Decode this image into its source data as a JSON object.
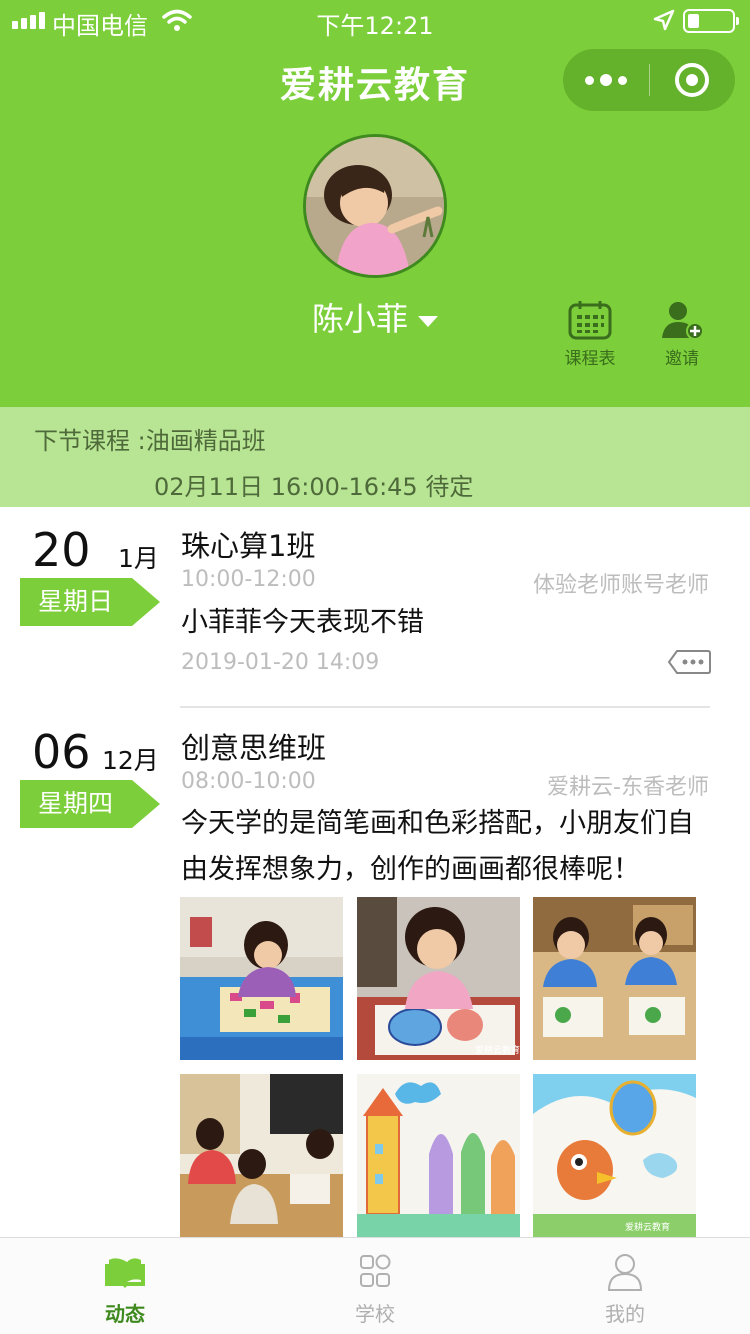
{
  "status_bar": {
    "carrier": "中国电信",
    "time": "下午12:21"
  },
  "header": {
    "title": "爱耕云教育",
    "student_name": "陈小菲",
    "tools": [
      {
        "label": "课程表",
        "icon": "calendar-icon"
      },
      {
        "label": "邀请",
        "icon": "invite-user-icon"
      }
    ]
  },
  "next_course": {
    "line1": "下节课程 :油画精品班",
    "line2": "02月11日 16:00-16:45 待定"
  },
  "entries": [
    {
      "day": "20",
      "month": "1月",
      "weekday": "星期日",
      "course": "珠心算1班",
      "time": "10:00-12:00",
      "teacher": "体验老师账号老师",
      "comment": "小菲菲今天表现不错",
      "posted": "2019-01-20 14:09"
    },
    {
      "day": "06",
      "month": "12月",
      "weekday": "星期四",
      "course": "创意思维班",
      "time": "08:00-10:00",
      "teacher": "爱耕云-东香老师",
      "comment": "今天学的是简笔画和色彩搭配，小朋友们自由发挥想象力，创作的画画都很棒呢！",
      "photo_watermark": "爱耕云教育"
    }
  ],
  "tabbar": {
    "tabs": [
      {
        "label": "动态",
        "icon": "open-book-icon",
        "active": true
      },
      {
        "label": "学校",
        "icon": "grid-apps-icon",
        "active": false
      },
      {
        "label": "我的",
        "icon": "user-profile-icon",
        "active": false
      }
    ]
  },
  "colors": {
    "primary_green": "#7ccf3b",
    "next_bar": "#b8e594",
    "muted_text": "#bdbdbd"
  }
}
